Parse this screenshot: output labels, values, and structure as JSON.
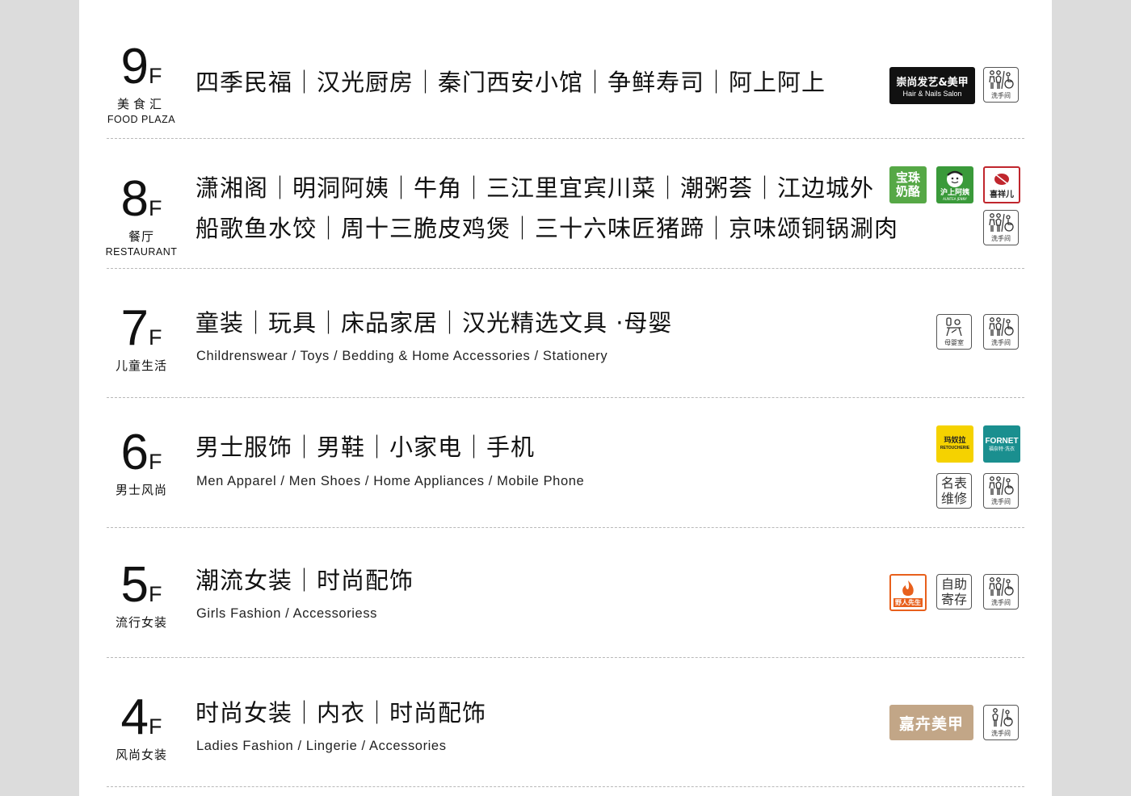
{
  "floors": {
    "f9": {
      "num": "9",
      "f": "F",
      "cn": "美食汇",
      "en": "FOOD PLAZA",
      "line1": "四季民福｜汉光厨房｜秦门西安小馆｜争鲜寿司｜阿上阿上",
      "brand": {
        "name": "崇尚发艺&美甲",
        "sub": "Hair & Nails Salon"
      },
      "restroom": "洗手间"
    },
    "f8": {
      "num": "8",
      "f": "F",
      "cn": "餐厅",
      "en": "RESTAURANT",
      "line1": "潇湘阁｜明洞阿姨｜牛角｜三江里宜宾川菜｜潮粥荟｜江边城外",
      "line2": "船歌鱼水饺｜周十三脆皮鸡煲｜三十六味匠猪蹄｜京味颂铜锅涮肉",
      "brands": {
        "b1": "宝珠奶酪",
        "b2": "沪上阿姨",
        "b2sub": "AUNTEA JENNY",
        "b3": "喜祥儿"
      },
      "restroom": "洗手间"
    },
    "f7": {
      "num": "7",
      "f": "F",
      "cn": "儿童生活",
      "line1": "童装｜玩具｜床品家居｜汉光精选文具 ·母婴",
      "en_line": "Childrenswear / Toys / Bedding & Home Accessories / Stationery",
      "nursery": "母婴室",
      "restroom": "洗手间"
    },
    "f6": {
      "num": "6",
      "f": "F",
      "cn": "男士风尚",
      "line1": "男士服饰｜男鞋｜小家电｜手机",
      "en_line": "Men Apparel / Men Shoes / Home Appliances / Mobile Phone",
      "brands": {
        "b1": "玛奴拉",
        "b1sub": "RETOUCHERIE",
        "b2": "FORNET",
        "b2sub": "福奈特·洗衣"
      },
      "watch": "名表维修",
      "restroom": "洗手间"
    },
    "f5": {
      "num": "5",
      "f": "F",
      "cn": "流行女装",
      "line1": "潮流女装｜时尚配饰",
      "en_line": "Girls Fashion / Accessoriess",
      "brand": "野人先生",
      "locker": "自助寄存",
      "restroom": "洗手间"
    },
    "f4": {
      "num": "4",
      "f": "F",
      "cn": "风尚女装",
      "line1": "时尚女装｜内衣｜时尚配饰",
      "en_line": "Ladies Fashion / Lingerie / Accessories",
      "brand": "嘉卉美甲",
      "restroom": "洗手间"
    }
  },
  "colors": {
    "background": "#dcdcdc",
    "panel": "#ffffff",
    "green": "#56a846",
    "red_border": "#c0262d",
    "yellow": "#f5d200",
    "teal": "#1a8f8f",
    "orange": "#e8601c",
    "tan": "#c2a687"
  },
  "icons": [
    "restroom-icon",
    "nursery-icon",
    "watch-repair-icon",
    "locker-icon"
  ]
}
